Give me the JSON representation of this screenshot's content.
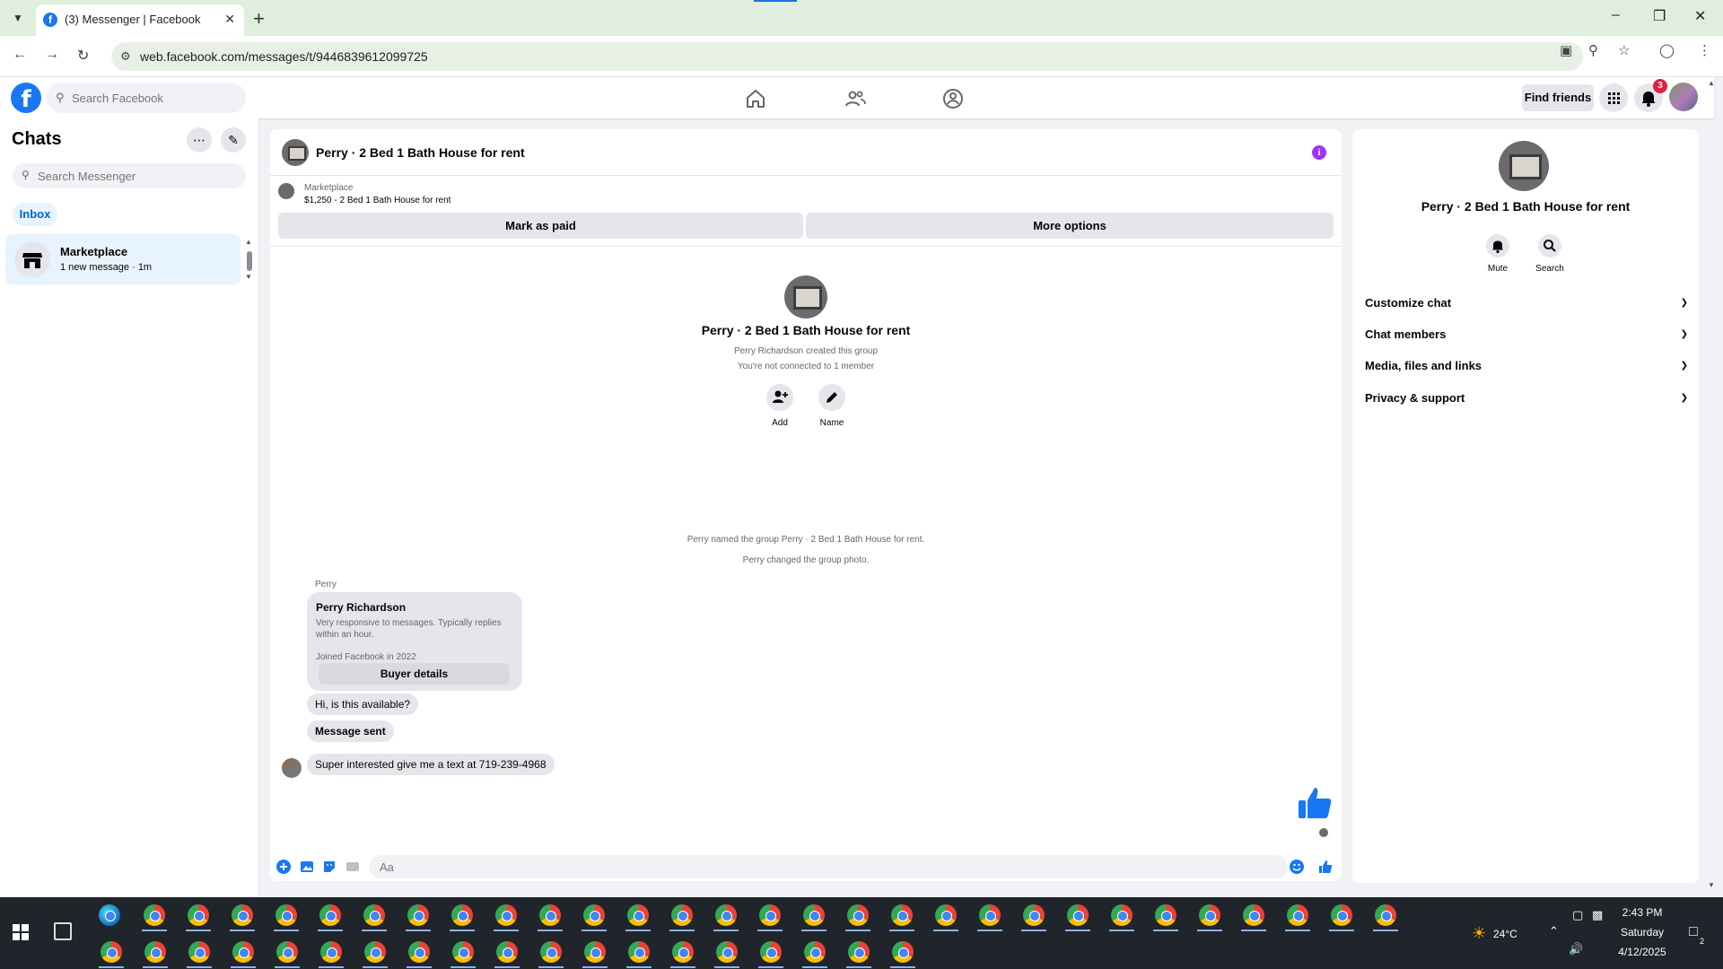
{
  "browser": {
    "tab_title": "(3) Messenger | Facebook",
    "tab_favicon": "f",
    "new_tab": "+",
    "url": "web.facebook.com/messages/t/9446839612099725",
    "window_controls": [
      "–",
      "❐",
      "✕"
    ]
  },
  "header": {
    "logo": "f",
    "search_placeholder": "Search Facebook",
    "find_friends_label": "Find friends",
    "notification_count": "3",
    "nav_icons": [
      "home-icon",
      "friends-icon",
      "groups-icon"
    ]
  },
  "sidebar": {
    "title": "Chats",
    "search_placeholder": "Search Messenger",
    "filter_label": "Inbox",
    "chats": [
      {
        "name": "Marketplace",
        "subtitle": "1 new message · 1m"
      }
    ]
  },
  "chat": {
    "title": "Perry · 2 Bed 1 Bath House for rent",
    "marketplace_label": "Marketplace",
    "listing": "$1,250 - 2 Bed 1 Bath House for rent",
    "mark_paid_label": "Mark as paid",
    "more_options_label": "More options",
    "group_title": "Perry · 2 Bed 1 Bath House for rent",
    "created_text": "Perry Richardson created this group",
    "not_connected_text": "You're not connected to 1 member",
    "add_label": "Add",
    "name_label": "Name",
    "system_messages": [
      "Perry named the group Perry · 2 Bed 1 Bath House for rent.",
      "Perry changed the group photo."
    ],
    "sender_label": "Perry",
    "buyer": {
      "name": "Perry Richardson",
      "description": "Very responsive to messages. Typically replies within an hour.",
      "joined": "Joined Facebook in 2022",
      "details_label": "Buyer details"
    },
    "messages": [
      "Hi, is this available?",
      "Message sent",
      "Super interested give me a text at 719-239-4968"
    ],
    "composer_placeholder": "Aa"
  },
  "right_panel": {
    "title": "Perry · 2 Bed 1 Bath House for rent",
    "mute_label": "Mute",
    "search_label": "Search",
    "sections": [
      "Customize chat",
      "Chat members",
      "Media, files and links",
      "Privacy & support"
    ]
  },
  "taskbar": {
    "temperature": "24°C",
    "time": "2:43 PM",
    "day": "Saturday",
    "date": "4/12/2025",
    "notification_count": "2"
  },
  "colors": {
    "facebook_blue": "#1877f2",
    "messenger_purple": "#a033ff",
    "badge_red": "#e41e3f"
  }
}
